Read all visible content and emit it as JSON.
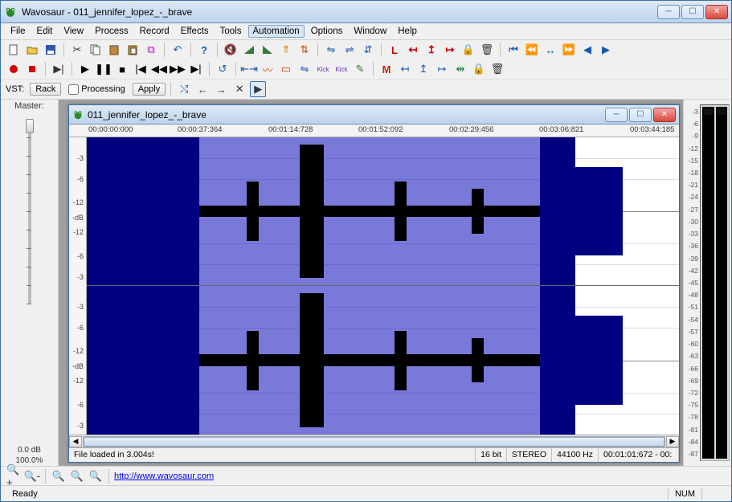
{
  "app": {
    "title": "Wavosaur - 011_jennifer_lopez_-_brave"
  },
  "menu": {
    "items": [
      "File",
      "Edit",
      "View",
      "Process",
      "Record",
      "Effects",
      "Tools",
      "Automation",
      "Options",
      "Window",
      "Help"
    ],
    "highlighted": "Automation"
  },
  "vstbar": {
    "label": "VST:",
    "rack": "Rack",
    "processing": "Processing",
    "apply": "Apply"
  },
  "master": {
    "label": "Master:",
    "db": "0.0 dB",
    "pct": "100.0%"
  },
  "doc": {
    "title": "011_jennifer_lopez_-_brave",
    "timeline": [
      "00:00:00:000",
      "00:00:37:364",
      "00:01:14:728",
      "00:01:52:092",
      "00:02:29:456",
      "00:03:06:821",
      "00:03:44:185"
    ],
    "db_ticks": [
      "-3",
      "-6",
      "-12",
      "-dB",
      "-12",
      "-6",
      "-3"
    ],
    "status": {
      "msg": "File loaded in 3.004s!",
      "bit": "16 bit",
      "mode": "STEREO",
      "rate": "44100 Hz",
      "sel": "00:01:01:672 - 00:"
    }
  },
  "meter": {
    "ticks": [
      "-3",
      "-6",
      "-9",
      "-12",
      "-15",
      "-18",
      "-21",
      "-24",
      "-27",
      "-30",
      "-33",
      "-36",
      "-39",
      "-42",
      "-45",
      "-48",
      "-51",
      "-54",
      "-57",
      "-60",
      "-63",
      "-66",
      "-69",
      "-72",
      "-75",
      "-78",
      "-81",
      "-84",
      "-87"
    ]
  },
  "bottom": {
    "link": "http://www.wavosaur.com"
  },
  "status": {
    "ready": "Ready",
    "num": "NUM"
  }
}
